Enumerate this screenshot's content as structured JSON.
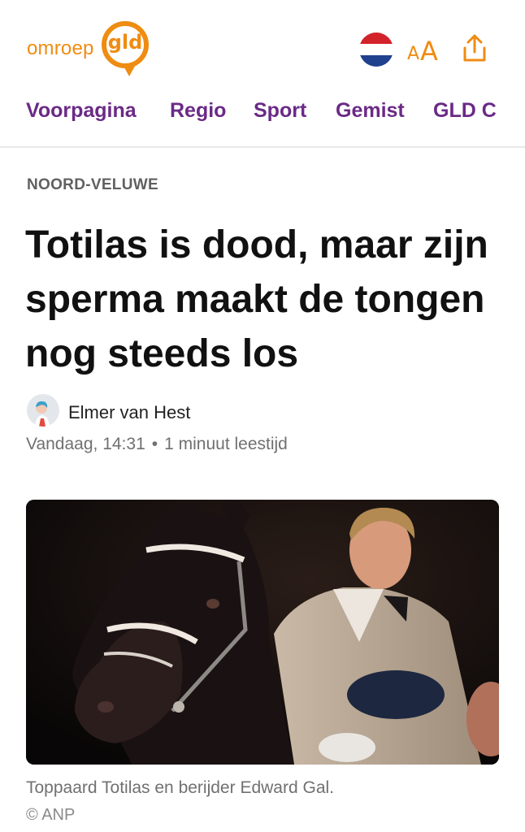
{
  "header": {
    "logo": {
      "word": "omroep",
      "badge": "gld"
    },
    "icons": {
      "flag": "netherlands-flag-icon",
      "font_size": "font-size-icon",
      "share": "share-icon"
    },
    "font_size_label_small": "A",
    "font_size_label_big": "A"
  },
  "nav": {
    "items": [
      {
        "label": "Voorpagina"
      },
      {
        "label": "Regio"
      },
      {
        "label": "Sport"
      },
      {
        "label": "Gemist"
      },
      {
        "label": "GLD C"
      }
    ]
  },
  "article": {
    "category": "NOORD-VELUWE",
    "headline": "Totilas is dood, maar zijn sperma maakt de tongen nog steeds los",
    "author": "Elmer van Hest",
    "date": "Vandaag, 14:31",
    "separator": "•",
    "reading_time": "1 minuut leestijd",
    "image_caption": "Toppaard Totilas en berijder Edward Gal.",
    "image_credit": "© ANP"
  },
  "colors": {
    "brand_orange": "#ef8c12",
    "nav_purple": "#6a2a86",
    "meta_gray": "#707070"
  }
}
